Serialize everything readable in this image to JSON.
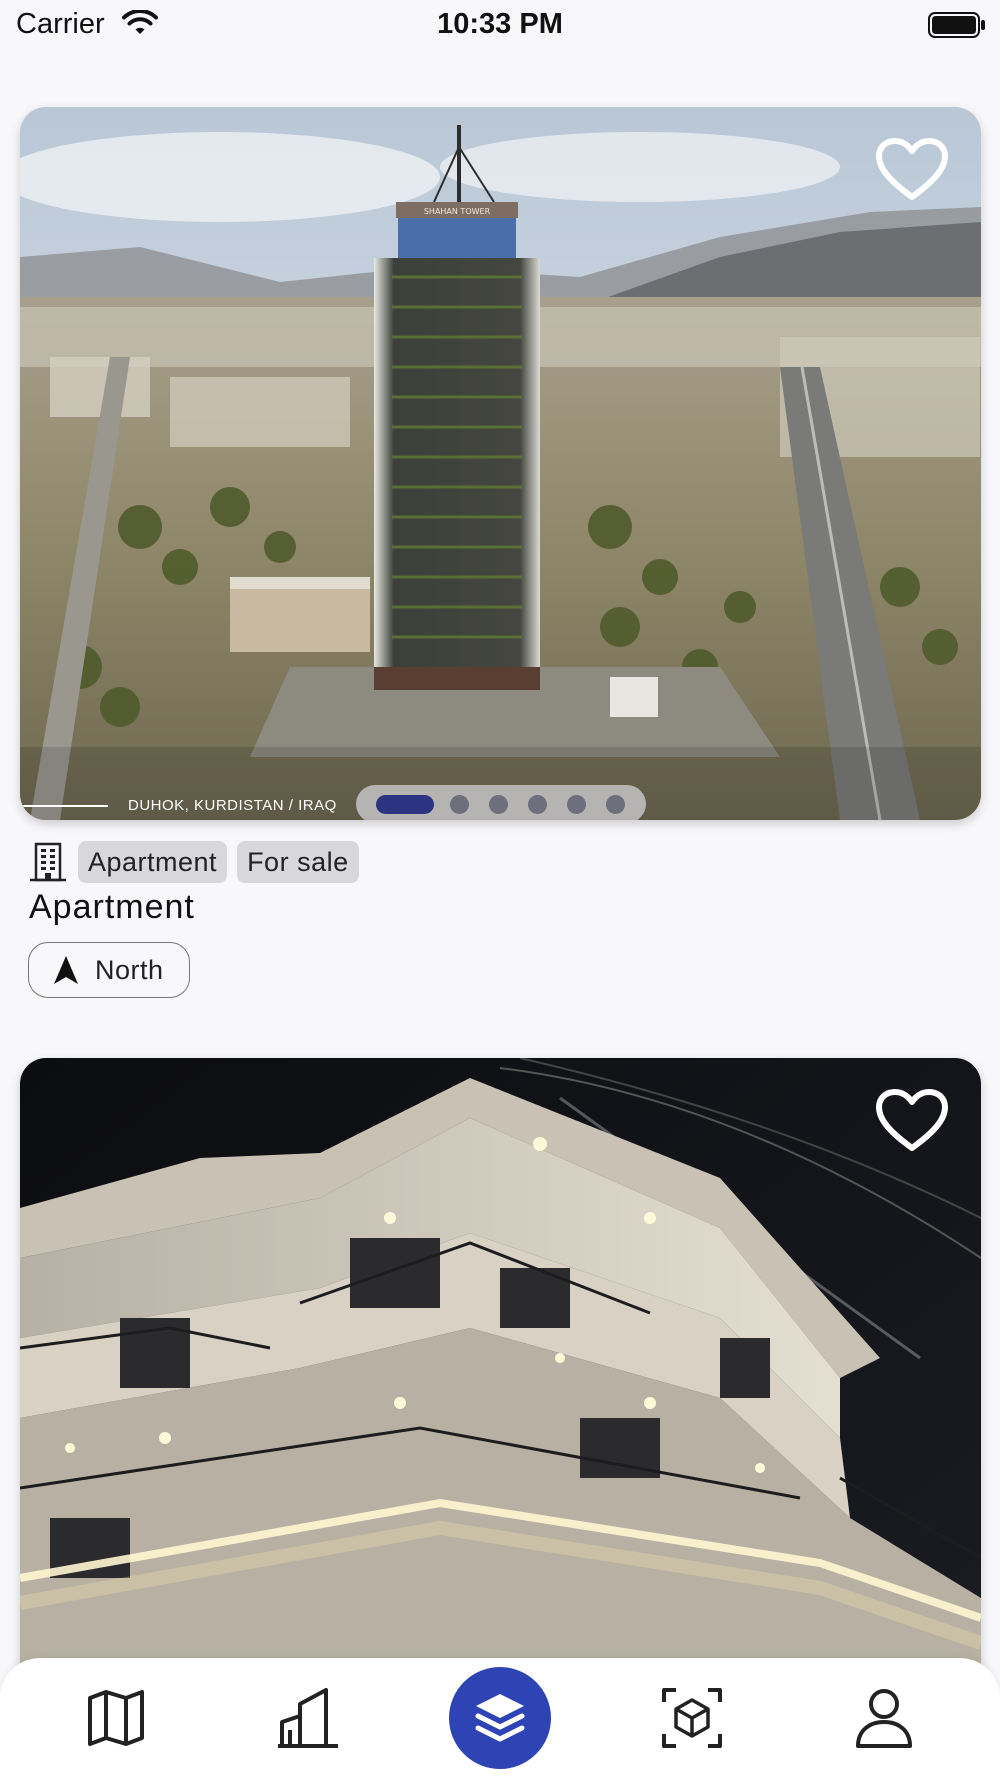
{
  "status_bar": {
    "carrier": "Carrier",
    "time": "10:33 PM"
  },
  "listings": [
    {
      "image_caption": "DUHOK, KURDISTAN / IRAQ",
      "photo_banner": "SHAHAN TOWER",
      "property_type": "Apartment",
      "offer_type": "For sale",
      "title": "Apartment",
      "direction": "North",
      "favorite": false,
      "carousel": {
        "count": 6,
        "active_index": 0
      }
    },
    {
      "favorite": false
    }
  ],
  "tab_bar": {
    "tabs": [
      {
        "icon": "map-icon",
        "active": false
      },
      {
        "icon": "buildings-icon",
        "active": false
      },
      {
        "icon": "layers-icon",
        "active": true
      },
      {
        "icon": "3d-cube-icon",
        "active": false
      },
      {
        "icon": "profile-icon",
        "active": false
      }
    ]
  },
  "colors": {
    "accent": "#2f44b4",
    "pager_active": "#2c3381",
    "background": "#f8f8fb",
    "chip_bg": "#d8d8db"
  }
}
